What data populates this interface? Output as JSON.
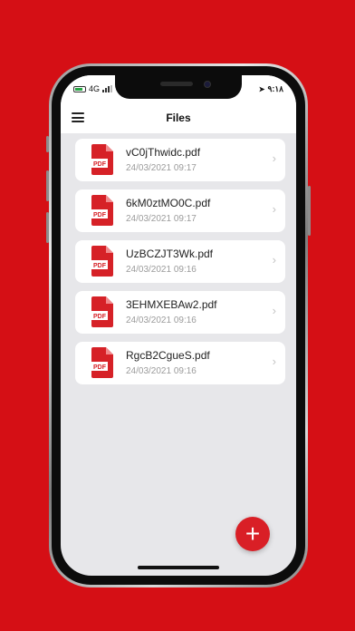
{
  "status_bar": {
    "network": "4G",
    "time": "٩:١٨"
  },
  "header": {
    "title": "Files"
  },
  "files": [
    {
      "name": "vC0jThwidc.pdf",
      "date": "24/03/2021 09:17",
      "icon_label": "PDF"
    },
    {
      "name": "6kM0ztMO0C.pdf",
      "date": "24/03/2021 09:17",
      "icon_label": "PDF"
    },
    {
      "name": "UzBCZJT3Wk.pdf",
      "date": "24/03/2021 09:16",
      "icon_label": "PDF"
    },
    {
      "name": "3EHMXEBAw2.pdf",
      "date": "24/03/2021 09:16",
      "icon_label": "PDF"
    },
    {
      "name": "RgcB2CgueS.pdf",
      "date": "24/03/2021 09:16",
      "icon_label": "PDF"
    }
  ],
  "fab": {
    "label": "+"
  },
  "colors": {
    "background": "#d50f15",
    "accent": "#d91f26",
    "pdf_icon": "#d62127"
  }
}
